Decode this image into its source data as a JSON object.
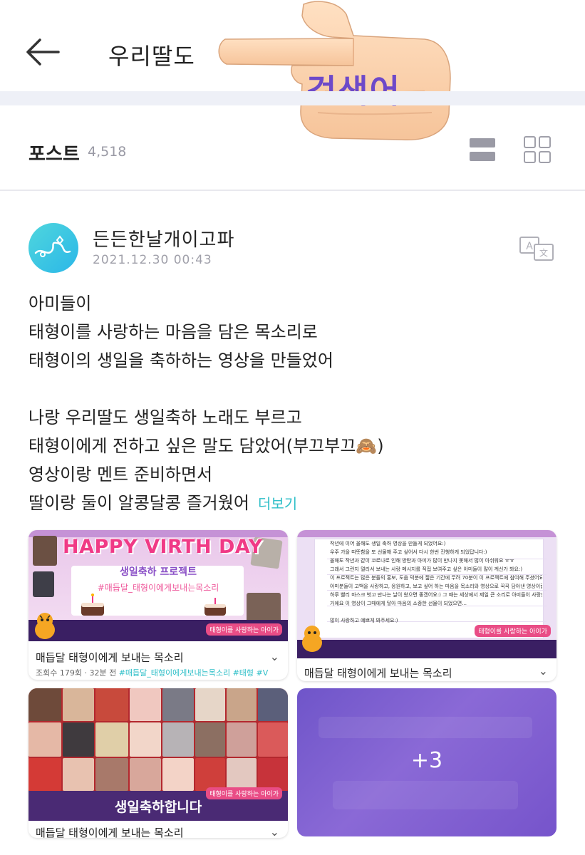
{
  "header": {
    "title": "우리딸도",
    "search_label": "검색어"
  },
  "posts": {
    "label": "포스트",
    "count": "4,518"
  },
  "post": {
    "author": "든든한날개이고파",
    "date": "2021.12.30 00:43",
    "lines": [
      "아미들이",
      "태형이를 사랑하는 마음을 담은 목소리로",
      "태형이의 생일을 축하하는 영상을 만들었어",
      "",
      "나랑 우리딸도 생일축하 노래도 부르고",
      "태형이에게 전하고 싶은 말도 담았어(부끄부끄🙈)",
      "영상이랑 멘트 준비하면서",
      "딸이랑 둘이 알콩달콩 즐거웠어"
    ],
    "more": "더보기"
  },
  "cards": [
    {
      "banner_title": "HAPPY VIRTH DAY",
      "banner_sub": "생일축하 프로젝트",
      "banner_tag": "#매듭달_태형이에게보내는목소리",
      "banner_foot": "태형이를 사랑하는 아이가",
      "caption": "매듭달 태형이에게 보내는 목소리",
      "meta": "조회수 179회 · 32분 전",
      "tags": "#매듭달_태형이에게보내는목소리 #태형 #V"
    },
    {
      "letter": [
        "작년에 이어 올해도 생일 축하 영상을 만들게 되었어요:)",
        "우주 가을 따뜻함을 또 선물해 주고 싶어서 다시 한번 진행하게 되었답니다:)",
        "올해도 작년과 같이 코로나로 인해 방탄과 아미가 많이 만나지 못해서 많이 아쉬워요 ㅠㅠ",
        "그래서 그런지 멀리서 보내는 사랑 메시지를 직접 보여주고 싶은 아미들이 많이 계신가 봐요:)",
        "이 프로젝트는 많은 분들의 홍보, 도움 덕분에 짧은 기간에 무려 70분이 이 프로젝트에 참여해 주셨어요!!!",
        "아미분들이 고백을 사랑하고, 응원하고, 보고 싶어 하는 마음을 목소리와 영상으로 꾹꾹 담아낸 영상이랍니다:)",
        "하루 빨리 마스크 벗고 만나는 날이 왔으면 좋겠어요:) 그 때는 세상에서 제일 큰 소리로 아미들이 사랑한다 이야기 할",
        "거에요 이 영상이 그때에게 닿아 마음의 소중한 선물이 되었으면...",
        "",
        "많이 사랑하고 예쁘게 봐주세요:)"
      ],
      "banner_foot": "태형이를 사랑하는 아이가",
      "caption": "매듭달 태형이에게 보내는 목소리"
    },
    {
      "banner_text": "생일축하합니다",
      "banner_foot": "태형이를 사랑하는 아이가",
      "caption": "매듭달 태형이에게 보내는 목소리"
    },
    {
      "more_count": "+3"
    }
  ],
  "colors": {
    "accent": "#2fbfc8",
    "search_word": "#6d49c9",
    "band": "#eef0f7",
    "banner_purple": "#4a2a74",
    "banner_pink": "#f03a86",
    "more_tile": "#7654cb"
  },
  "icons": [
    "back-arrow-icon",
    "list-view-icon",
    "grid-view-icon",
    "translate-icon",
    "chevron-down-icon",
    "pointing-hand-icon"
  ]
}
